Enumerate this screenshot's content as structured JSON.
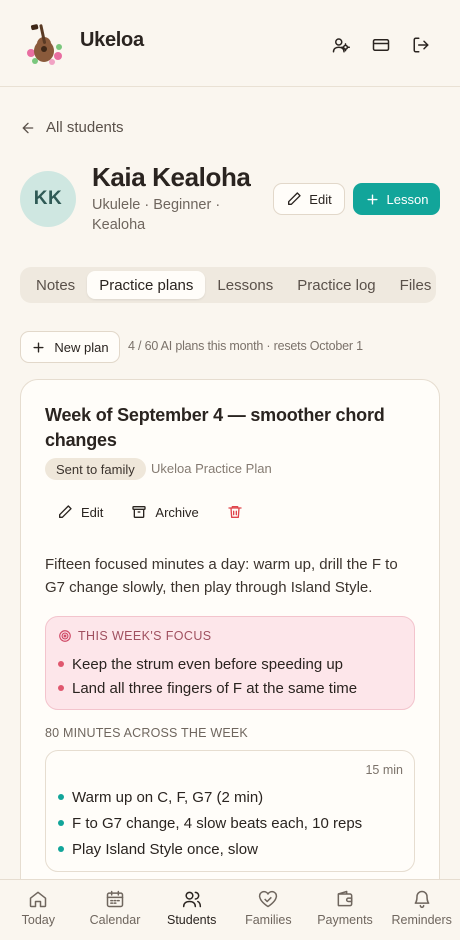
{
  "app": {
    "title": "Ukeloa"
  },
  "header_icons": [
    "users-icon",
    "card-icon",
    "logout-icon"
  ],
  "back": {
    "label": "All students"
  },
  "student": {
    "initials": "KK",
    "name": "Kaia Kealoha",
    "meta": "Ukulele · Beginner · Kealoha",
    "edit_label": "Edit",
    "lesson_label": "Lesson"
  },
  "tabs": [
    {
      "label": "Notes"
    },
    {
      "label": "Practice plans",
      "active": true
    },
    {
      "label": "Lessons"
    },
    {
      "label": "Practice log"
    },
    {
      "label": "Files"
    }
  ],
  "plans": {
    "new_label": "New plan",
    "usage": "4 / 60 AI plans this month · resets October 1"
  },
  "plan": {
    "title": "Week of September 4 — smoother chord changes",
    "status": "Sent to family",
    "source": "Ukeloa Practice Plan",
    "edit_label": "Edit",
    "archive_label": "Archive",
    "description": "Fifteen focused minutes a day: warm up, drill the F to G7 change slowly, then play through Island Style.",
    "focus": {
      "heading": "THIS WEEK'S FOCUS",
      "items": [
        "Keep the strum even before speeding up",
        "Land all three fingers of F at the same time"
      ]
    },
    "minutes_label": "80 MINUTES ACROSS THE WEEK",
    "exercise": {
      "duration": "15 min",
      "items": [
        "Warm up on C, F, G7 (2 min)",
        "F to G7 change, 4 slow beats each, 10 reps",
        "Play Island Style once, slow"
      ]
    }
  },
  "colors": {
    "accent": "#12a59a",
    "danger": "#e0454c",
    "focus_bg": "#fde6ea",
    "avatar_bg": "#cfe7e1"
  },
  "nav": [
    {
      "label": "Today",
      "icon": "home-icon"
    },
    {
      "label": "Calendar",
      "icon": "calendar-icon"
    },
    {
      "label": "Students",
      "icon": "users-icon",
      "active": true
    },
    {
      "label": "Families",
      "icon": "heart-handshake-icon"
    },
    {
      "label": "Payments",
      "icon": "wallet-icon"
    },
    {
      "label": "Reminders",
      "icon": "bell-icon"
    }
  ]
}
